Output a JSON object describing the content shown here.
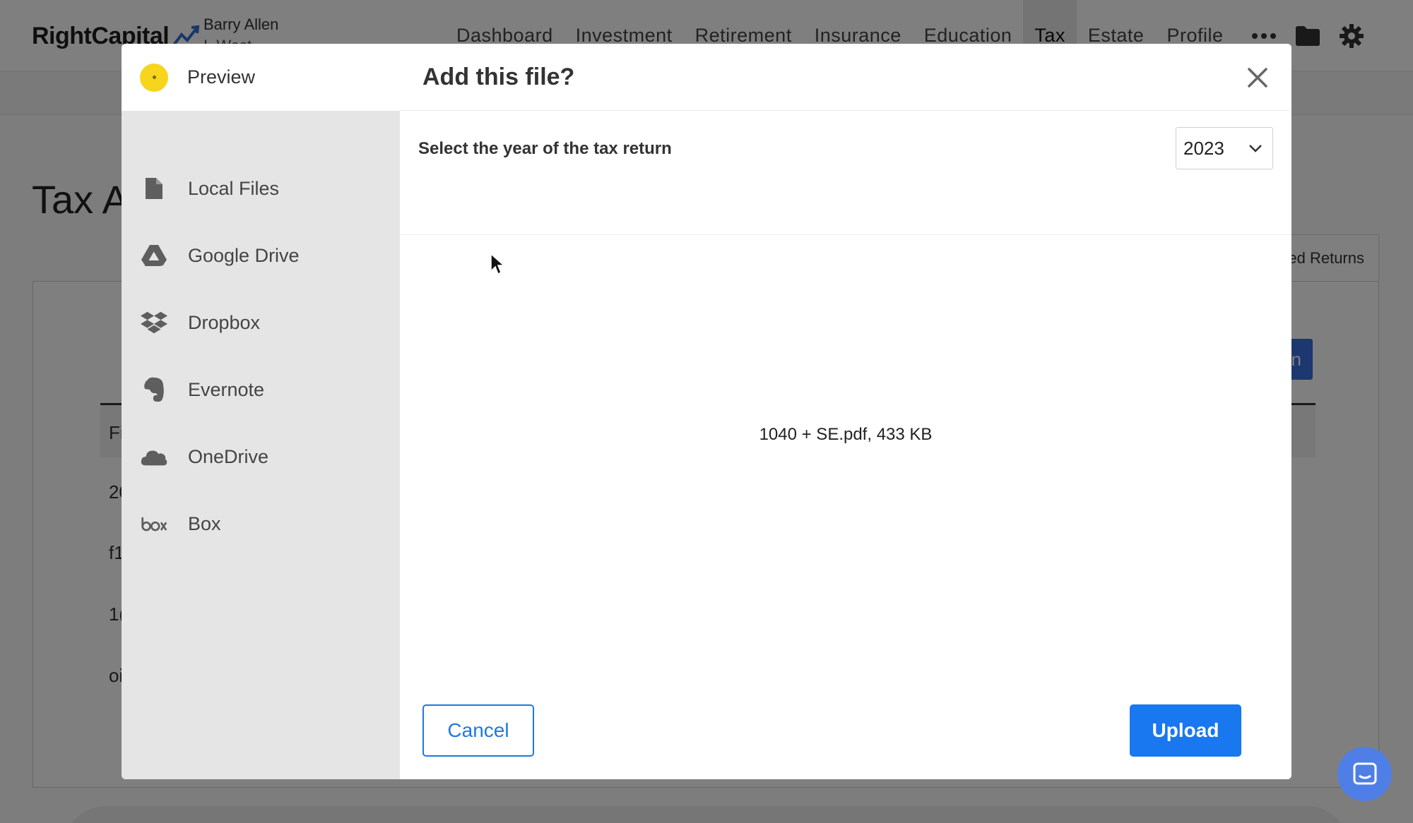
{
  "app": {
    "logo": "RightCapital",
    "client_name": "Barry Allen",
    "client_sub": "I. West",
    "nav": [
      "Dashboard",
      "Investment",
      "Retirement",
      "Insurance",
      "Education",
      "Tax",
      "Estate",
      "Profile"
    ],
    "active_nav": "Tax",
    "page_title": "Tax A",
    "bg_tab": "ed Returns",
    "bg_button": "n",
    "bg_rows": [
      "Fi",
      "20",
      "f1",
      "1(",
      "oi"
    ]
  },
  "modal": {
    "sidebar": {
      "preview": "Preview",
      "items": [
        {
          "label": "Local Files",
          "icon": "file-icon"
        },
        {
          "label": "Google Drive",
          "icon": "google-drive-icon"
        },
        {
          "label": "Dropbox",
          "icon": "dropbox-icon"
        },
        {
          "label": "Evernote",
          "icon": "evernote-icon"
        },
        {
          "label": "OneDrive",
          "icon": "onedrive-icon"
        },
        {
          "label": "Box",
          "icon": "box-icon"
        }
      ]
    },
    "title": "Add this file?",
    "year_label": "Select the year of the tax return",
    "year_value": "2023",
    "file_info": "1040 + SE.pdf, 433 KB",
    "cancel_label": "Cancel",
    "upload_label": "Upload"
  },
  "colors": {
    "accent": "#1977f0",
    "preview_dot": "#f7d51d",
    "sidebar_bg": "#e5e5e5"
  }
}
